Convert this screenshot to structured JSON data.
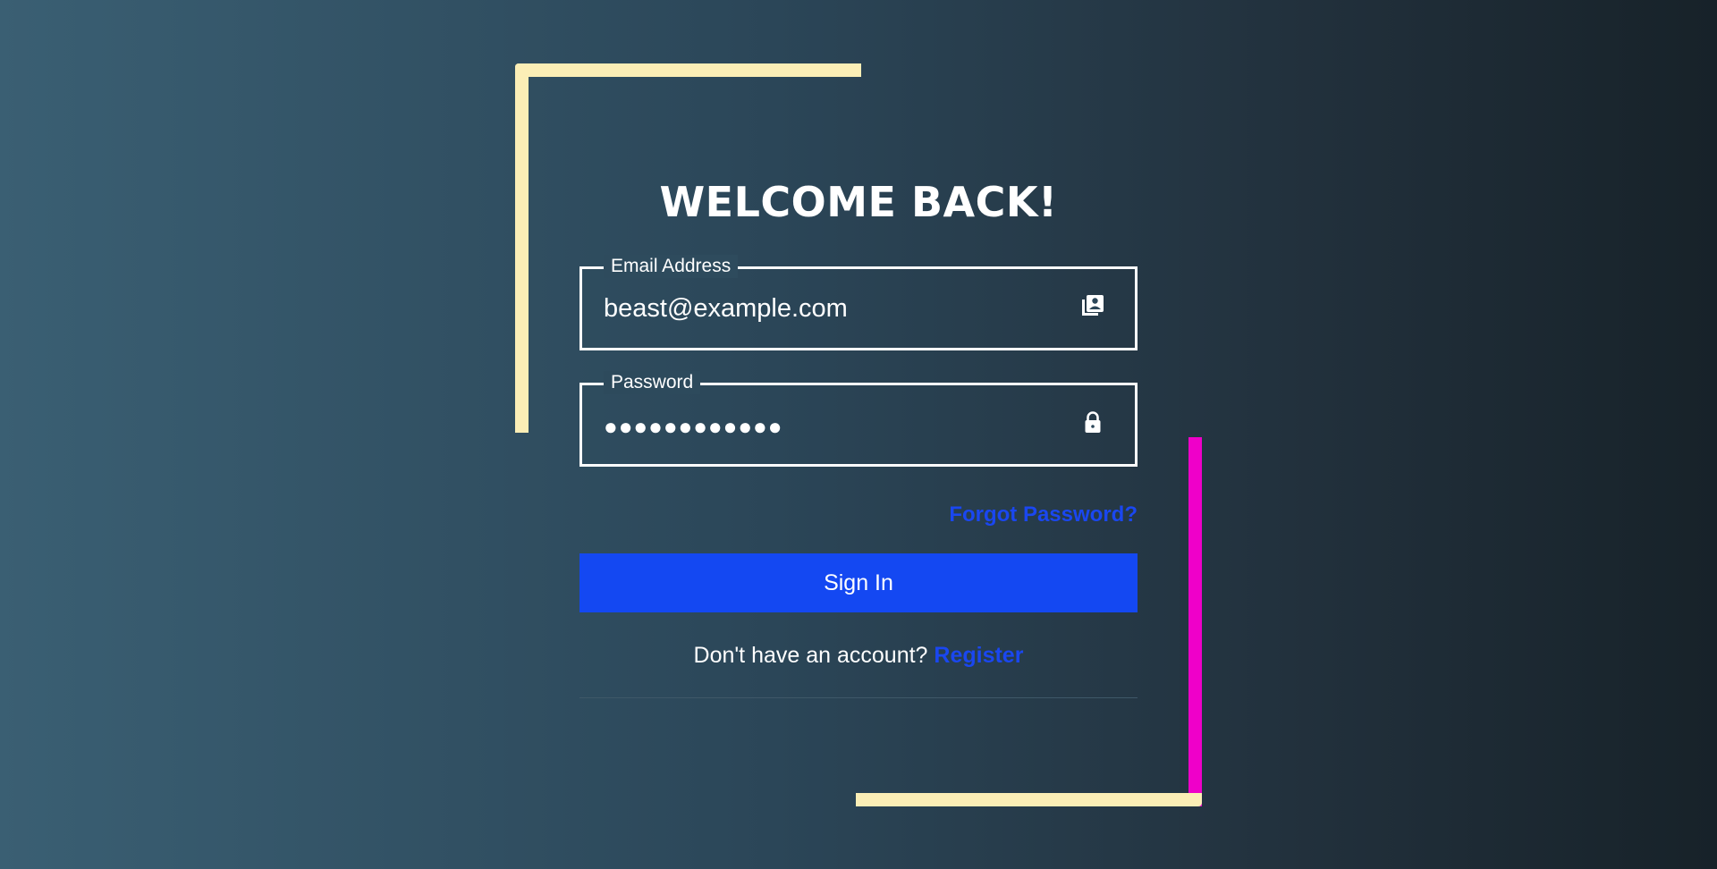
{
  "form": {
    "title": "WELCOME BACK!",
    "email": {
      "label": "Email Address",
      "value": "beast@example.com",
      "icon": "contact-card-icon"
    },
    "password": {
      "label": "Password",
      "value": "●●●●●●●●●●●●",
      "icon": "lock-icon"
    },
    "forgot_password": "Forgot Password?",
    "submit_label": "Sign In",
    "register_prompt": "Don't have an account?",
    "register_link": "Register"
  },
  "colors": {
    "accent_blue": "#1448f2",
    "frame_cream": "#fbeeb6",
    "frame_magenta": "#ef00c9"
  }
}
